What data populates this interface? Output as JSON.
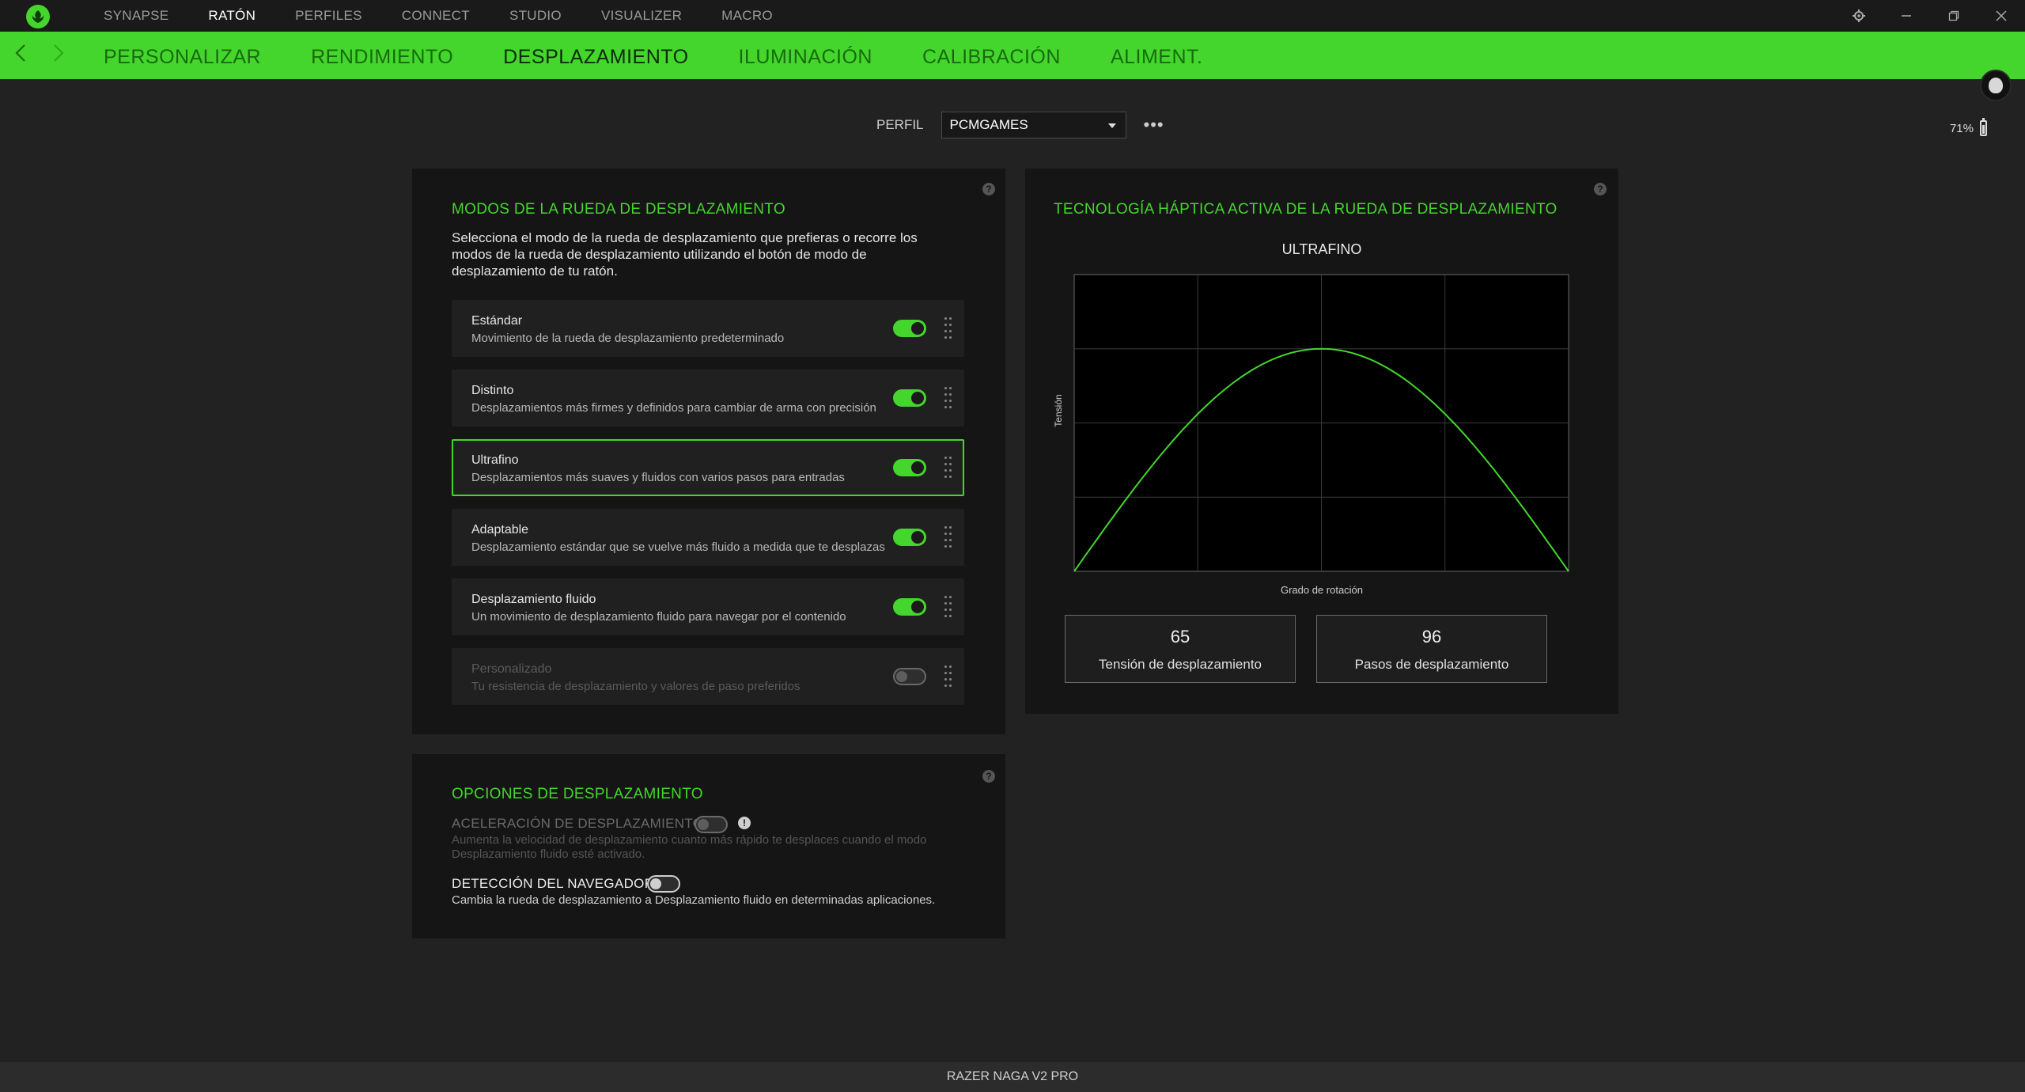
{
  "topnav": {
    "items": [
      "SYNAPSE",
      "RATÓN",
      "PERFILES",
      "CONNECT",
      "STUDIO",
      "VISUALIZER",
      "MACRO"
    ],
    "active_index": 1
  },
  "subnav": {
    "items": [
      "PERSONALIZAR",
      "RENDIMIENTO",
      "DESPLAZAMIENTO",
      "ILUMINACIÓN",
      "CALIBRACIÓN",
      "ALIMENT."
    ],
    "active_index": 2
  },
  "profile": {
    "label": "PERFIL",
    "selected": "PCMGAMES",
    "more": "•••"
  },
  "battery": {
    "text": "71%",
    "level": 0.71
  },
  "modes_panel": {
    "title": "MODOS DE LA RUEDA DE DESPLAZAMIENTO",
    "description": "Selecciona el modo de la rueda de desplazamiento que prefieras o recorre los modos de la rueda de desplazamiento utilizando el botón de modo de desplazamiento de tu ratón.",
    "modes": [
      {
        "name": "Estándar",
        "desc": "Movimiento de la rueda de desplazamiento predeterminado",
        "enabled": true
      },
      {
        "name": "Distinto",
        "desc": "Desplazamientos más firmes y definidos para cambiar de arma con precisión",
        "enabled": true
      },
      {
        "name": "Ultrafino",
        "desc": "Desplazamientos más suaves y fluidos con varios pasos para entradas",
        "enabled": true
      },
      {
        "name": "Adaptable",
        "desc": "Desplazamiento estándar que se vuelve más fluido a medida que te desplazas",
        "enabled": true
      },
      {
        "name": "Desplazamiento fluido",
        "desc": "Un movimiento de desplazamiento fluido para navegar por el contenido",
        "enabled": true
      },
      {
        "name": "Personalizado",
        "desc": "Tu resistencia de desplazamiento y valores de paso preferidos",
        "enabled": false
      }
    ]
  },
  "options_panel": {
    "title": "OPCIONES DE DESPLAZAMIENTO",
    "accel_title": "ACELERACIÓN DE DESPLAZAMIENTO",
    "accel_desc": "Aumenta la velocidad de desplazamiento cuanto más rápido te desplaces cuando el modo Desplazamiento fluido esté activado.",
    "browser_title": "DETECCIÓN DEL NAVEGADOR",
    "browser_desc": "Cambia la rueda de desplazamiento a Desplazamiento fluido en determinadas aplicaciones."
  },
  "haptic_panel": {
    "title": "TECNOLOGÍA HÁPTICA ACTIVA DE LA RUEDA DE DESPLAZAMIENTO",
    "tension_value": "65",
    "tension_label": "Tensión de desplazamiento",
    "steps_value": "96",
    "steps_label": "Pasos de desplazamiento"
  },
  "chart_data": {
    "type": "line",
    "title": "ULTRAFINO",
    "xlabel": "Grado de rotación",
    "ylabel": "Tensión",
    "grid": true,
    "color": "#44d62c",
    "xlim": [
      0,
      1
    ],
    "ylim": [
      0,
      1
    ],
    "series": [
      {
        "x": [
          0,
          0.1,
          0.2,
          0.3,
          0.4,
          0.5,
          0.6,
          0.7,
          0.8,
          0.9,
          1.0
        ],
        "values": [
          0,
          0.235,
          0.447,
          0.616,
          0.724,
          0.75,
          0.724,
          0.616,
          0.447,
          0.235,
          0
        ]
      }
    ]
  },
  "footer": {
    "device": "RAZER NAGA V2 PRO"
  },
  "colors": {
    "accent": "#44d62c",
    "background": "#222222",
    "panel": "#151515"
  }
}
